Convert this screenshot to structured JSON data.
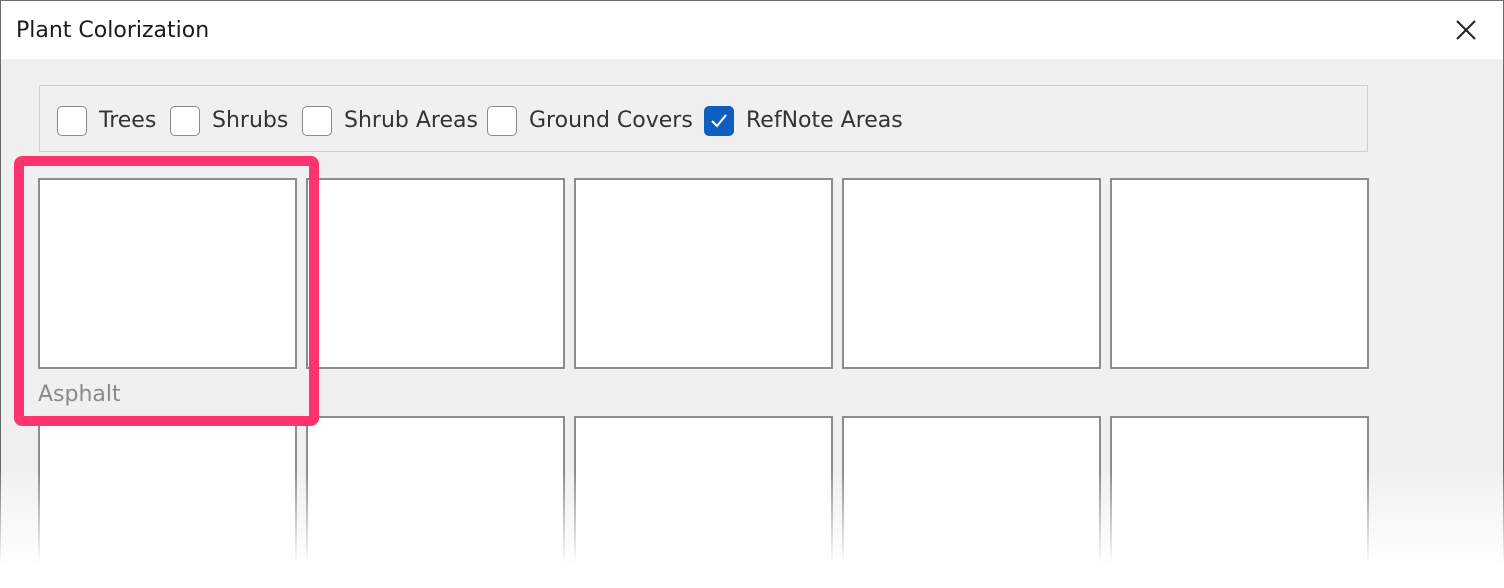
{
  "window": {
    "title": "Plant Colorization"
  },
  "filters": [
    {
      "label": "Trees",
      "checked": false
    },
    {
      "label": "Shrubs",
      "checked": false
    },
    {
      "label": "Shrub Areas",
      "checked": false
    },
    {
      "label": "Ground Covers",
      "checked": false
    },
    {
      "label": "RefNote Areas",
      "checked": true
    }
  ],
  "tiles": {
    "first_caption": "Asphalt"
  },
  "colors": {
    "checkbox_checked": "#0f5fc0",
    "highlight": "#ff3370",
    "tile_border": "#8c8c8c",
    "caption_text": "#8a8a8a"
  },
  "icons": {
    "close": "close-icon",
    "check": "checkmark-icon"
  }
}
